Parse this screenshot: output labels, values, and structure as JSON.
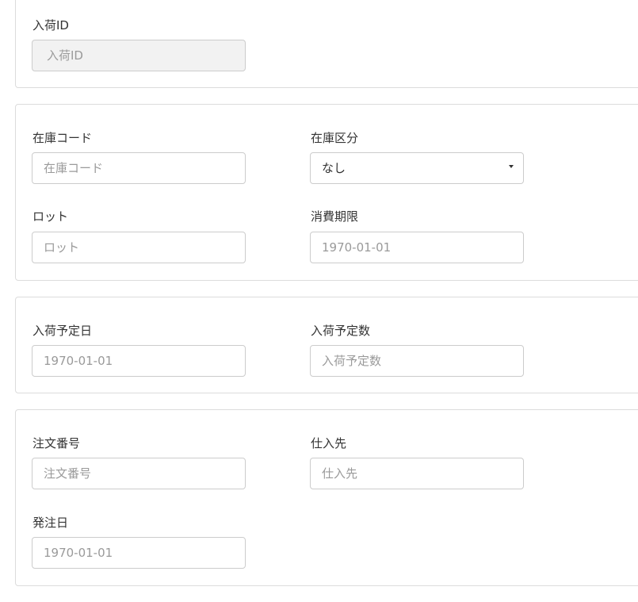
{
  "section1": {
    "arrival_id_label": "入荷ID",
    "arrival_id_placeholder": "入荷ID"
  },
  "section2": {
    "stock_code_label": "在庫コード",
    "stock_code_placeholder": "在庫コード",
    "stock_type_label": "在庫区分",
    "stock_type_value": "なし",
    "lot_label": "ロット",
    "lot_placeholder": "ロット",
    "expiry_label": "消費期限",
    "expiry_value": "1970-01-01"
  },
  "section3": {
    "planned_date_label": "入荷予定日",
    "planned_date_value": "1970-01-01",
    "planned_qty_label": "入荷予定数",
    "planned_qty_placeholder": "入荷予定数"
  },
  "section4": {
    "order_no_label": "注文番号",
    "order_no_placeholder": "注文番号",
    "supplier_label": "仕入先",
    "supplier_placeholder": "仕入先",
    "order_date_label": "発注日",
    "order_date_value": "1970-01-01"
  },
  "colors": {
    "border": "#dcdcdc",
    "input_border": "#cccccc",
    "disabled_bg": "#f2f2f2",
    "placeholder": "#9a9a9a",
    "text": "#333333"
  }
}
